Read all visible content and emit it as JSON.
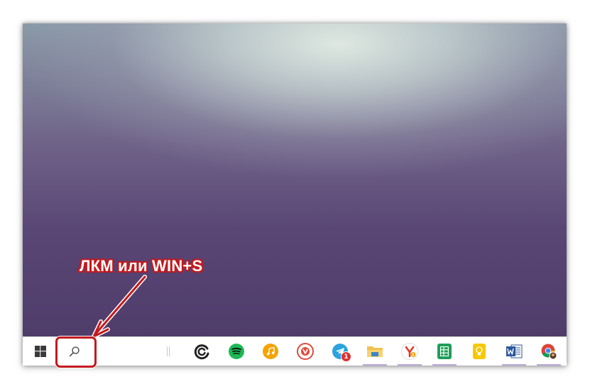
{
  "annotation": {
    "text": "ЛКМ или WIN+S",
    "color": "#c21a1f"
  },
  "taskbar": {
    "start_icon": "windows-logo-icon",
    "search_icon": "search-icon",
    "apps": [
      {
        "name": "cortana-edge",
        "icon": "circle-arc-icon",
        "color": "#1e1e1e"
      },
      {
        "name": "spotify",
        "icon": "spotify-icon",
        "color": "#1db954"
      },
      {
        "name": "music",
        "icon": "music-note-icon",
        "color": "#f5a300"
      },
      {
        "name": "vivaldi",
        "icon": "v-shield-icon",
        "color": "#e04b3a"
      },
      {
        "name": "telegram",
        "icon": "paper-plane-icon",
        "color": "#2aa3df",
        "badge": "1"
      },
      {
        "name": "file-explorer",
        "icon": "folder-icon",
        "color": "#f2c14e"
      },
      {
        "name": "yandex-browser",
        "icon": "y-icon",
        "color": "#e23a2d"
      },
      {
        "name": "google-sheets",
        "icon": "sheets-icon",
        "color": "#1e9e5a"
      },
      {
        "name": "google-keep",
        "icon": "lightbulb-icon",
        "color": "#f7c800"
      },
      {
        "name": "microsoft-word",
        "icon": "word-icon",
        "color": "#2b579a"
      },
      {
        "name": "chrome-profile",
        "icon": "chrome-icon",
        "color": "#db4437"
      }
    ]
  }
}
